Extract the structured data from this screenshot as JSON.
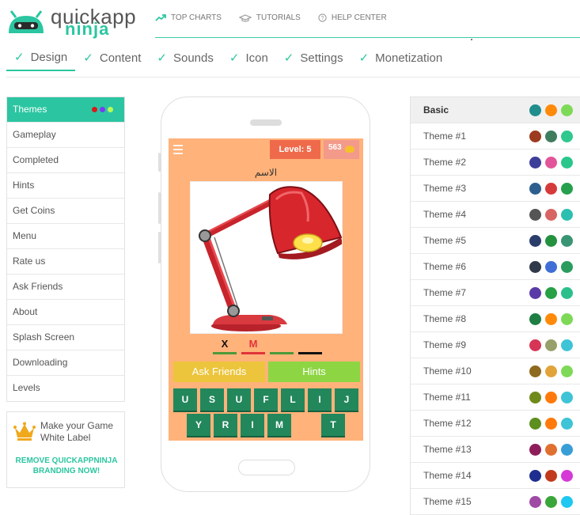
{
  "brand": {
    "word1": "quickapp",
    "word2": "ninja"
  },
  "topnav": [
    {
      "label": "TOP CHARTS",
      "icon": "trend-icon"
    },
    {
      "label": "TUTORIALS",
      "icon": "graduation-cap-icon"
    },
    {
      "label": "HELP CENTER",
      "icon": "help-circle-icon"
    }
  ],
  "steps": [
    "Design",
    "Content",
    "Sounds",
    "Icon",
    "Settings",
    "Monetization"
  ],
  "sidebar": {
    "items": [
      "Themes",
      "Gameplay",
      "Completed",
      "Hints",
      "Get Coins",
      "Menu",
      "Rate us",
      "Ask Friends",
      "About",
      "Splash Screen",
      "Downloading",
      "Levels"
    ],
    "active_dots": [
      "#d81b1b",
      "#7a3cf2",
      "#b6ff59"
    ]
  },
  "promo": {
    "title": "Make your Game White Label",
    "link": "REMOVE QUICKAPPNINJA BRANDING NOW!"
  },
  "game": {
    "level": "Level: 5",
    "coins": "563",
    "word": "الاسم",
    "answer": [
      {
        "letter": "X",
        "color": "#111111",
        "bar": "#4c9a3a"
      },
      {
        "letter": "M",
        "color": "#e0343a",
        "bar": "#e0343a"
      },
      {
        "letter": "",
        "color": "#111111",
        "bar": "#4c9a3a"
      },
      {
        "letter": "",
        "color": "#111111",
        "bar": "#111111"
      }
    ],
    "ask_friends": "Ask Friends",
    "hints": "Hints",
    "keys_row1": [
      "U",
      "S",
      "U",
      "F",
      "L",
      "I",
      "J"
    ],
    "keys_row2": [
      "Y",
      "R",
      "I",
      "M",
      "",
      "T"
    ]
  },
  "themes": [
    {
      "name": "Basic",
      "colors": [
        "#1f8e8c",
        "#ff8a0a",
        "#7ed957"
      ]
    },
    {
      "name": "Theme #1",
      "colors": [
        "#9b3b1f",
        "#3e7d5e",
        "#2fc88f"
      ]
    },
    {
      "name": "Theme #2",
      "colors": [
        "#3d3d9a",
        "#e2559a",
        "#29c78c"
      ]
    },
    {
      "name": "Theme #3",
      "colors": [
        "#2c5f8e",
        "#d63b3b",
        "#27a04e"
      ]
    },
    {
      "name": "Theme #4",
      "colors": [
        "#555555",
        "#d86464",
        "#2bbfb0"
      ]
    },
    {
      "name": "Theme #5",
      "colors": [
        "#2b3d6a",
        "#24913f",
        "#3a9575"
      ]
    },
    {
      "name": "Theme #6",
      "colors": [
        "#2e3a4a",
        "#3f6fd6",
        "#2a9d5e"
      ]
    },
    {
      "name": "Theme #7",
      "colors": [
        "#5a3aa6",
        "#27a046",
        "#2bbf8c"
      ]
    },
    {
      "name": "Theme #8",
      "colors": [
        "#1e7e44",
        "#ff8a0a",
        "#7ed957"
      ]
    },
    {
      "name": "Theme #9",
      "colors": [
        "#d63556",
        "#96a06a",
        "#3ec4d6"
      ]
    },
    {
      "name": "Theme #10",
      "colors": [
        "#8e6a1e",
        "#e2a43a",
        "#7ed957"
      ]
    },
    {
      "name": "Theme #11",
      "colors": [
        "#6f8a1a",
        "#ff7a0a",
        "#3ec4d6"
      ]
    },
    {
      "name": "Theme #12",
      "colors": [
        "#5c8f1e",
        "#ff7a0a",
        "#3ec4d6"
      ]
    },
    {
      "name": "Theme #13",
      "colors": [
        "#8e1e5a",
        "#e07030",
        "#3a9ed6"
      ]
    },
    {
      "name": "Theme #14",
      "colors": [
        "#1e2e8e",
        "#c23a1e",
        "#d63ad6"
      ]
    },
    {
      "name": "Theme #15",
      "colors": [
        "#a04aa6",
        "#3aa63a",
        "#1ec8f0"
      ]
    }
  ]
}
